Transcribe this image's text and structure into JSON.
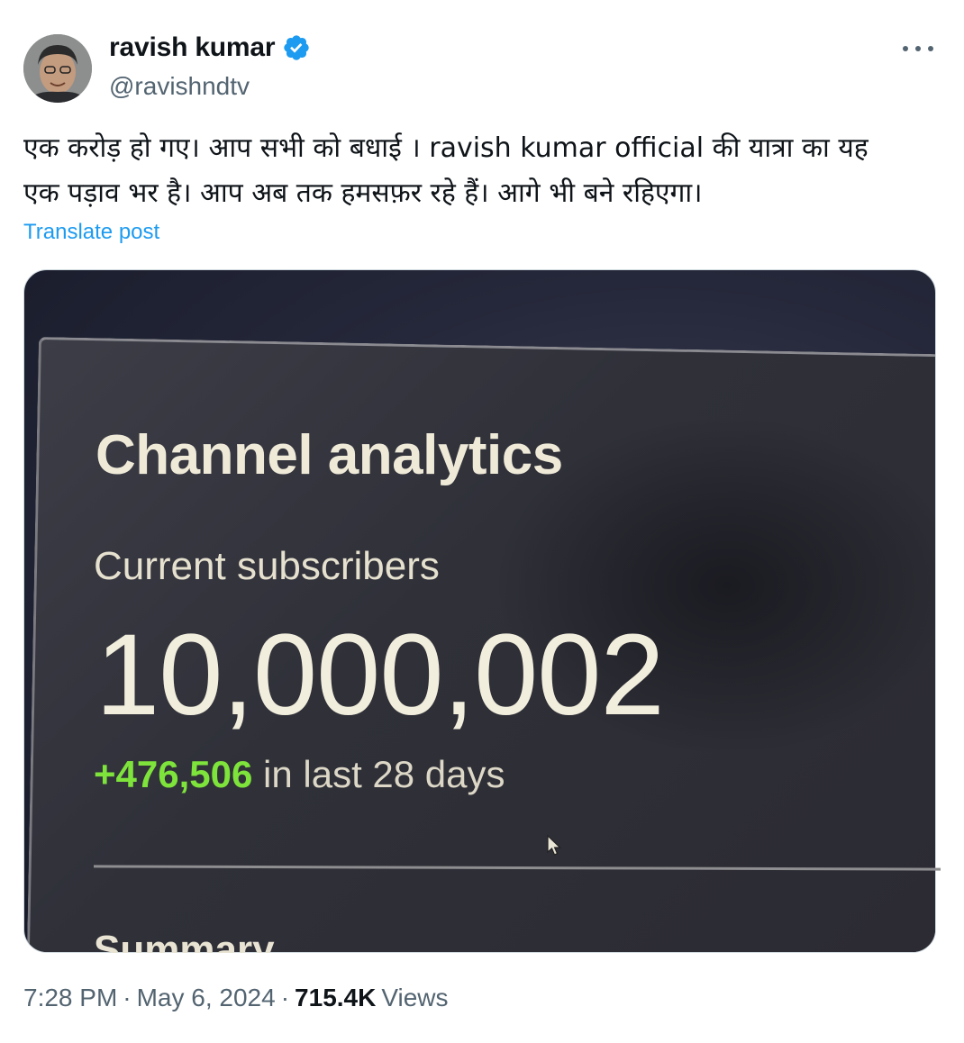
{
  "author": {
    "display_name": "ravish kumar",
    "handle": "@ravishndtv",
    "verified": true
  },
  "post": {
    "text_lines": [
      "एक करोड़ हो गए। आप सभी को बधाई । ravish kumar official की यात्रा का यह",
      "एक पड़ाव भर है। आप अब तक हमसफ़र रहे हैं। आगे भी बने रहिएगा।"
    ],
    "translate_label": "Translate post"
  },
  "media": {
    "title": "Channel analytics",
    "subtitle": "Current subscribers",
    "subscriber_count": "10,000,002",
    "growth_value": "+476,506",
    "growth_suffix": " in last 28 days",
    "summary_heading": "Summary"
  },
  "footer": {
    "time": "7:28 PM",
    "separator": "·",
    "date": "May 6, 2024",
    "views_count": "715.4K",
    "views_label": "Views"
  },
  "colors": {
    "accent": "#1d9bf0",
    "text": "#0f1419",
    "secondary": "#536471",
    "growth_green": "#7ee33b"
  },
  "icons": [
    "verified-badge-icon",
    "more-options-icon",
    "mouse-cursor-icon"
  ]
}
